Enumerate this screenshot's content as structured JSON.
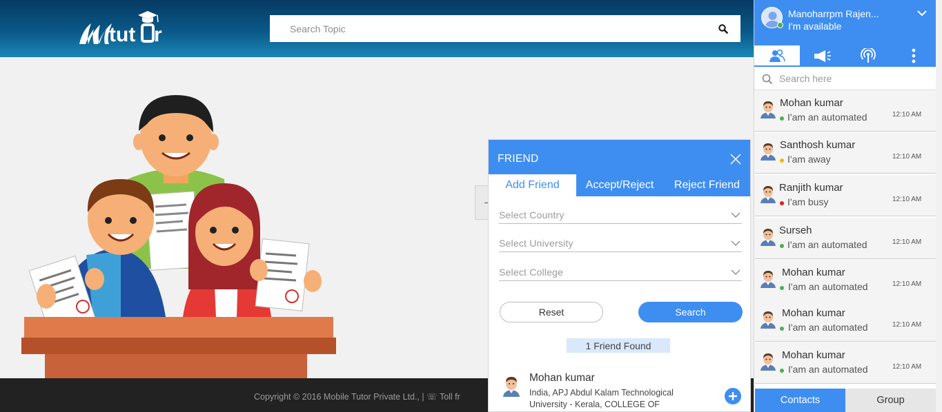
{
  "header": {
    "logo_text": "Mtutor",
    "search_placeholder": "Search Topic"
  },
  "footer": {
    "copyright": "Copyright © 2016 Mobile Tutor Private Ltd.,  |  ☏ Toll fr"
  },
  "dialog": {
    "title": "FRIEND",
    "tabs": [
      {
        "label": "Add Friend",
        "active": true
      },
      {
        "label": "Accept/Reject",
        "active": false
      },
      {
        "label": "Reject Friend",
        "active": false
      }
    ],
    "selects": {
      "country": "Select Country",
      "university": "Select University",
      "college": "Select College"
    },
    "reset_label": "Reset",
    "search_label": "Search",
    "found_text": "1 Friend Found",
    "result": {
      "name": "Mohan kumar",
      "detail": "India, APJ Abdul Kalam Technological University - Kerala, COLLEGE OF"
    }
  },
  "chat": {
    "user": {
      "name": "Manoharrpm Rajen...",
      "status": "I'm available"
    },
    "tab_icons": [
      "contacts-icon",
      "megaphone-icon",
      "broadcast-icon",
      "more-icon"
    ],
    "search_placeholder": "Search here",
    "contacts": [
      {
        "name": "Mohan kumar",
        "status": "I'am an automated",
        "time": "12:10 AM",
        "status_color": "#4caf50"
      },
      {
        "name": "Santhosh kumar",
        "status": "I'am away",
        "time": "12:10 AM",
        "status_color": "#f5b700"
      },
      {
        "name": "Ranjith kumar",
        "status": "I'am busy",
        "time": "12:10 AM",
        "status_color": "#e02020"
      },
      {
        "name": "Surseh",
        "status": "I'am an automated",
        "time": "12:10 AM",
        "status_color": "#4caf50"
      },
      {
        "name": "Mohan kumar",
        "status": "I'am an automated",
        "time": "12:10 AM",
        "status_color": "#4caf50"
      },
      {
        "name": "Mohan kumar",
        "status": "I'am an automated",
        "time": "12:10 AM",
        "status_color": "#4caf50"
      },
      {
        "name": "Mohan kumar",
        "status": "I'am an automated",
        "time": "12:10 AM",
        "status_color": "#4caf50"
      }
    ],
    "bottom_tabs": [
      {
        "label": "Contacts",
        "active": true
      },
      {
        "label": "Group",
        "active": false
      }
    ]
  },
  "colors": {
    "accent": "#3e8ef2",
    "header_dark": "#063a63",
    "footer": "#222222"
  }
}
